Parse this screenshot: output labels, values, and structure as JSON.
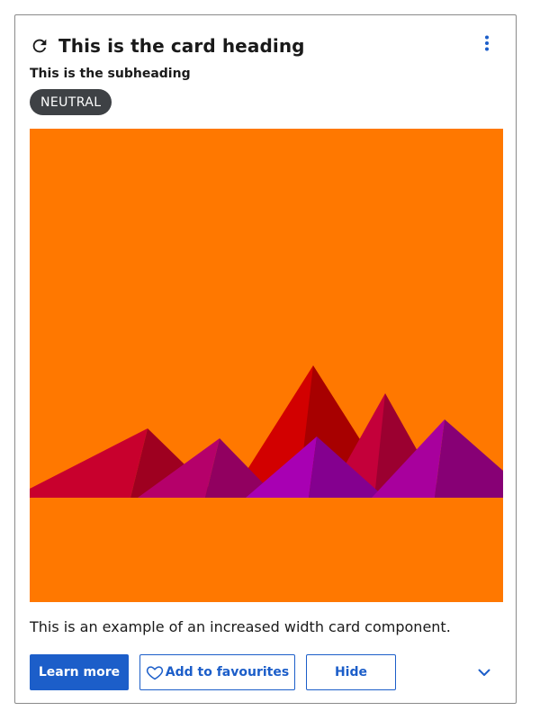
{
  "card": {
    "heading": "This is the card heading",
    "subheading": "This is the subheading",
    "badge": "NEUTRAL",
    "description": "This is an example of an increased width card component.",
    "actions": {
      "learn_more": "Learn more",
      "add_to_favourites": "Add to favourites",
      "hide": "Hide"
    },
    "icons": {
      "heading_icon": "refresh-icon",
      "menu_icon": "more-vertical-icon",
      "favourite_icon": "heart-icon",
      "expand_icon": "chevron-down-icon"
    }
  },
  "colors": {
    "primary": "#1c5ec9",
    "badge_bg": "#3e4145",
    "media_bg": "#ff7800",
    "border": "#8a8a8a",
    "text": "#1a1a1a"
  }
}
